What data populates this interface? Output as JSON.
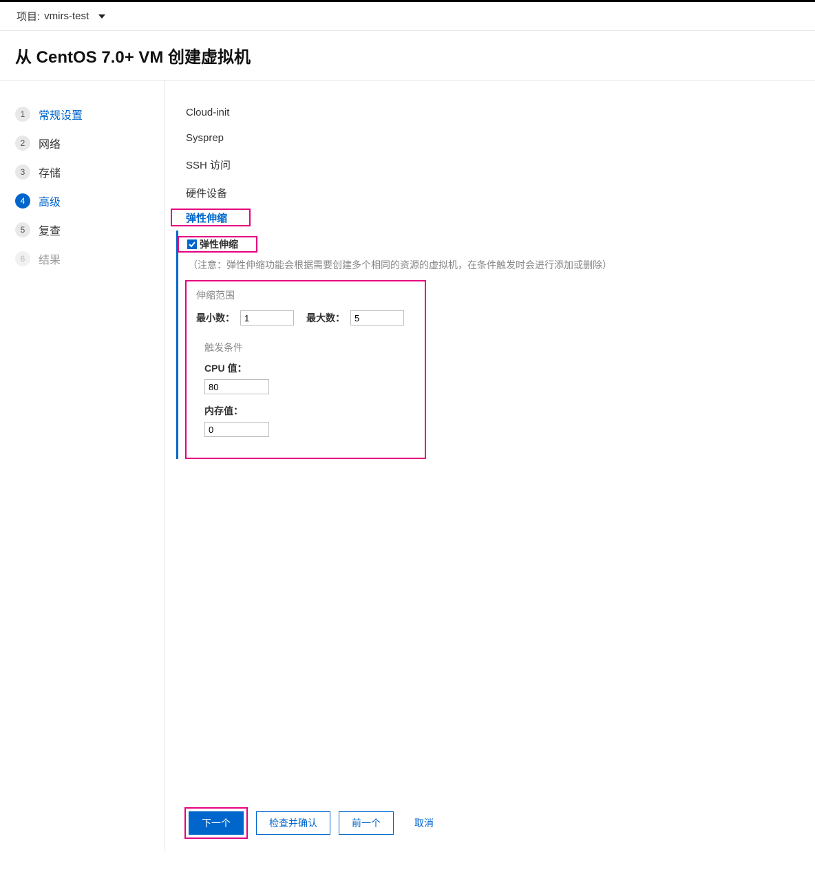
{
  "topbar": {
    "project_label": "项目: ",
    "project_value": "vmirs-test"
  },
  "page_title": "从 CentOS 7.0+ VM 创建虚拟机",
  "steps": [
    {
      "num": "1",
      "label": "常规设置"
    },
    {
      "num": "2",
      "label": "网络"
    },
    {
      "num": "3",
      "label": "存储"
    },
    {
      "num": "4",
      "label": "高级"
    },
    {
      "num": "5",
      "label": "复查"
    },
    {
      "num": "6",
      "label": "结果"
    }
  ],
  "advanced_tabs": {
    "cloud_init": "Cloud-init",
    "sysprep": "Sysprep",
    "ssh": "SSH 访问",
    "hardware": "硬件设备",
    "autoscale": "弹性伸缩"
  },
  "autoscale": {
    "checkbox_label": "弹性伸缩",
    "checkbox_checked": true,
    "note": "（注意：弹性伸缩功能会根据需要创建多个相同的资源的虚拟机，在条件触发时会进行添加或删除）",
    "range_title": "伸缩范围",
    "min_label": "最小数：",
    "min_value": "1",
    "max_label": "最大数：",
    "max_value": "5",
    "trigger_title": "触发条件",
    "cpu_label": "CPU 值：",
    "cpu_value": "80",
    "mem_label": "内存值：",
    "mem_value": "0"
  },
  "footer": {
    "next": "下一个",
    "review": "检查并确认",
    "prev": "前一个",
    "cancel": "取消"
  }
}
